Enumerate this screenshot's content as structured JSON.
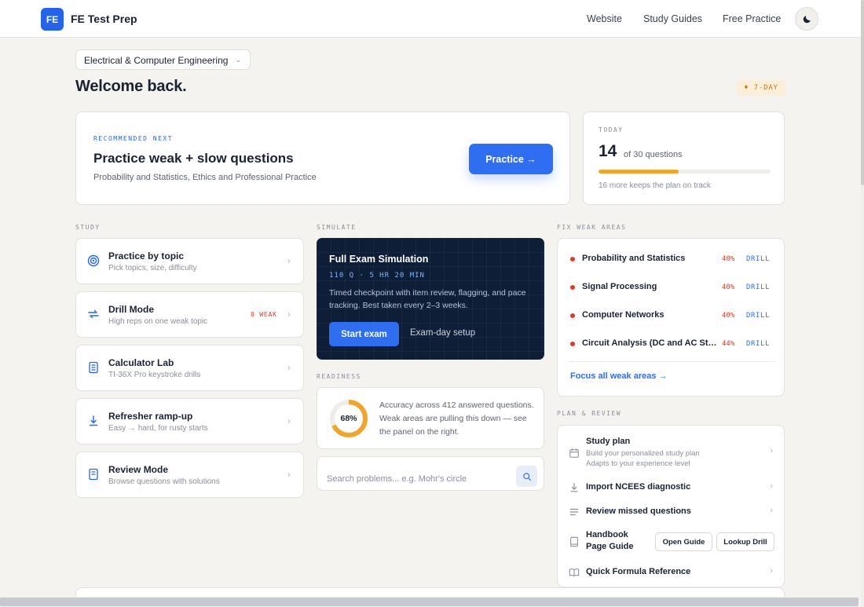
{
  "header": {
    "logo_badge": "FE",
    "logo_text": "FE Test Prep",
    "nav": [
      "Website",
      "Study Guides",
      "Free Practice"
    ],
    "theme_icon": "moon-icon"
  },
  "discipline": {
    "selected": "Electrical & Computer Engineering"
  },
  "welcome": "Welcome back.",
  "streak": "♦ 7-DAY",
  "recommended": {
    "eyebrow": "RECOMMENDED NEXT",
    "title": "Practice weak + slow questions",
    "subtitle": "Probability and Statistics, Ethics and Professional Practice",
    "button": "Practice →"
  },
  "today": {
    "eyebrow": "TODAY",
    "count": "14",
    "of_text": "of 30 questions",
    "progress_fraction": 0.467,
    "note": "16 more keeps the plan on track",
    "progress_color": "#efa62d"
  },
  "sections": {
    "study": "STUDY",
    "simulate": "SIMULATE",
    "readiness": "READINESS",
    "fix": "FIX WEAK AREAS",
    "plan": "PLAN & REVIEW"
  },
  "study_items": [
    {
      "title": "Practice by topic",
      "sub": "Pick topics, size, difficulty",
      "icon": "target-icon"
    },
    {
      "title": "Drill Mode",
      "sub": "High reps on one weak topic",
      "icon": "repeat-icon",
      "badge": "8 WEAK"
    },
    {
      "title": "Calculator Lab",
      "sub": "TI-36X Pro keystroke drills",
      "icon": "calculator-icon"
    },
    {
      "title": "Refresher ramp-up",
      "sub": "Easy → hard, for rusty starts",
      "icon": "download-icon"
    },
    {
      "title": "Review Mode",
      "sub": "Browse questions with solutions",
      "icon": "book-icon"
    }
  ],
  "simulation": {
    "title": "Full Exam Simulation",
    "meta": "110 Q · 5 HR 20 MIN",
    "desc": "Timed checkpoint with item review, flagging, and pace tracking. Best taken every 2–3 weeks.",
    "start": "Start exam",
    "setup": "Exam-day setup"
  },
  "readiness": {
    "percent_label": "68%",
    "fraction": 0.68,
    "text": "Accuracy across 412 answered questions. Weak areas are pulling this down — see the panel on the right.",
    "ring_color": "#efa62d"
  },
  "search": {
    "placeholder": "Search problems... e.g. Mohr's circle"
  },
  "weak_areas": [
    {
      "name": "Probability and Statistics",
      "pct": "40%",
      "drill": "DRILL"
    },
    {
      "name": "Signal Processing",
      "pct": "40%",
      "drill": "DRILL"
    },
    {
      "name": "Computer Networks",
      "pct": "40%",
      "drill": "DRILL"
    },
    {
      "name": "Circuit Analysis (DC and AC Steady State)",
      "pct": "44%",
      "drill": "DRILL"
    }
  ],
  "focus_link": "Focus all weak areas →",
  "plan": {
    "study_plan": {
      "title": "Study plan",
      "sub1": "Build your personalized study plan",
      "sub2": "Adapts to your experience level"
    },
    "import": "Import NCEES diagnostic",
    "review_missed": "Review missed questions",
    "handbook": {
      "line1": "Handbook",
      "line2": "Page Guide",
      "open": "Open Guide",
      "lookup": "Lookup Drill"
    },
    "formula": "Quick Formula Reference"
  }
}
